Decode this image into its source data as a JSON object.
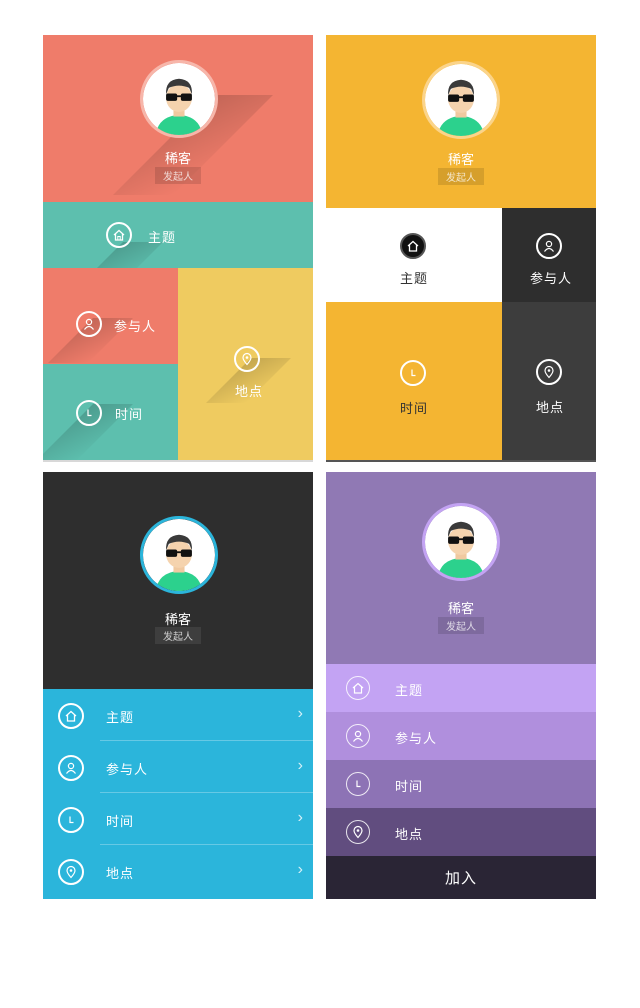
{
  "profile": {
    "name": "稀客",
    "role": "发起人"
  },
  "menu": {
    "topic": "主题",
    "participants": "参与人",
    "time": "时间",
    "location": "地点"
  },
  "join_label": "加入",
  "colors": {
    "coral": "#EF7C6A",
    "teal": "#5DBFAE",
    "mustard": "#EFCB60",
    "amber": "#F4B532",
    "dark": "#2E2E2E",
    "charcoal": "#3D3D3D",
    "sky": "#2BB5DB",
    "purple": "#9079B4",
    "lavender": "#C3A3F3",
    "night": "#2A2535"
  },
  "icons": [
    "home-icon",
    "user-icon",
    "clock-icon",
    "pin-icon",
    "chevron-right-icon"
  ]
}
